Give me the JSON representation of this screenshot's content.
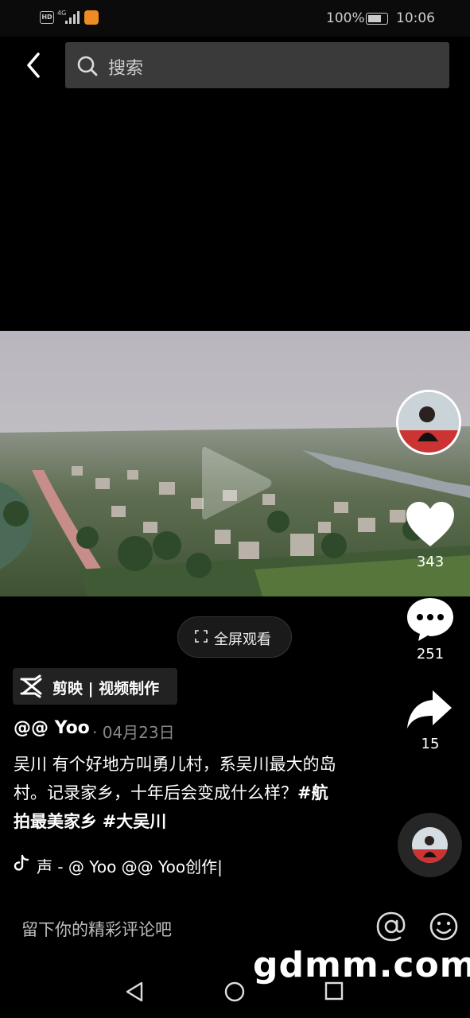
{
  "status_bar": {
    "network": "4G",
    "battery": "100%",
    "time": "10:06"
  },
  "search": {
    "placeholder": "搜索"
  },
  "video": {
    "fullscreen_label": "全屏观看"
  },
  "actions": {
    "likes": "343",
    "comments": "251",
    "shares": "15"
  },
  "capcut_badge": {
    "text": "剪映 | 视频制作"
  },
  "post": {
    "author": "@@ Yoo",
    "date": "· 04月23日",
    "caption_text": "吴川 有个好地方叫勇儿村，系吴川最大的岛村。记录家乡，十年后会变成什么样？",
    "hashtags": [
      "#航拍最美家乡",
      "#大吴川"
    ]
  },
  "music": {
    "text": "声 - @ Yoo    @@ Yoo创作|"
  },
  "comment_input": {
    "placeholder": "留下你的精彩评论吧"
  },
  "watermark": "gdmm.com"
}
